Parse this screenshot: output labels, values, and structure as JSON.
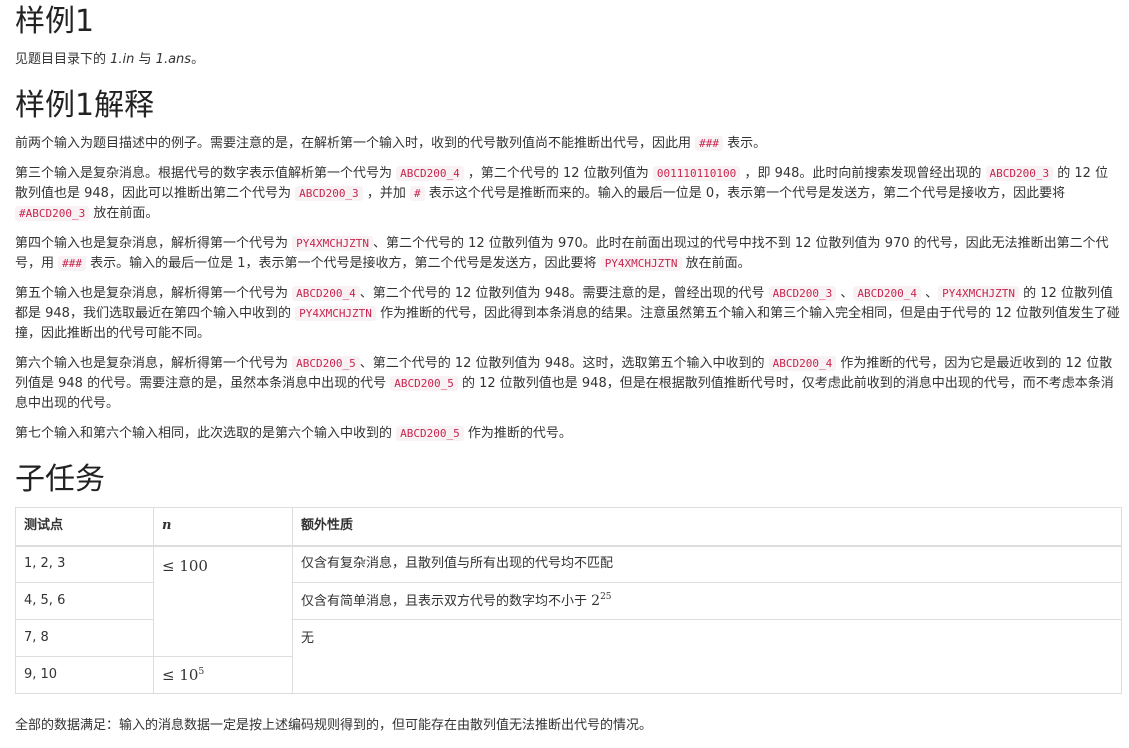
{
  "sample": {
    "title": "样例1",
    "desc_before": "见题目目录下的 ",
    "file_in": "1.in",
    "desc_mid": " 与 ",
    "file_ans": "1.ans",
    "desc_after": "。"
  },
  "explanation": {
    "title": "样例1解释",
    "p1": {
      "t1": "前两个输入为题目描述中的例子。需要注意的是，在解析第一个输入时，收到的代号散列值尚不能推断出代号，因此用 ",
      "c1": "###",
      "t2": " 表示。"
    },
    "p2": {
      "t1": "第三个输入是复杂消息。根据代号的数字表示值解析第一个代号为 ",
      "c1": "ABCD200_4",
      "t2": " ，第二个代号的 12 位散列值为 ",
      "c2": "001110110100",
      "t3": " ，即 948。此时向前搜索发现曾经出现的 ",
      "c3": "ABCD200_3",
      "t4": " 的 12 位散列值也是 948，因此可以推断出第二个代号为 ",
      "c4": "ABCD200_3",
      "t5": " ，并加 ",
      "c5": "#",
      "t6": " 表示这个代号是推断而来的。输入的最后一位是 0，表示第一个代号是发送方，第二个代号是接收方，因此要将 ",
      "c6": "#ABCD200_3",
      "t7": " 放在前面。"
    },
    "p3": {
      "t1": "第四个输入也是复杂消息，解析得第一个代号为 ",
      "c1": "PY4XMCHJZTN",
      "t2": "、第二个代号的 12 位散列值为 970。此时在前面出现过的代号中找不到 12 位散列值为 970 的代号，因此无法推断出第二个代号，用 ",
      "c2": "###",
      "t3": " 表示。输入的最后一位是 1，表示第一个代号是接收方，第二个代号是发送方，因此要将 ",
      "c3": "PY4XMCHJZTN",
      "t4": " 放在前面。"
    },
    "p4": {
      "t1": "第五个输入也是复杂消息，解析得第一个代号为 ",
      "c1": "ABCD200_4",
      "t2": "、第二个代号的 12 位散列值为 948。需要注意的是，曾经出现的代号 ",
      "c2": "ABCD200_3",
      "t3": " 、",
      "c3": "ABCD200_4",
      "t4": " 、",
      "c4": "PY4XMCHJZTN",
      "t5": " 的 12 位散列值都是 948，我们选取最近在第四个输入中收到的 ",
      "c5": "PY4XMCHJZTN",
      "t6": " 作为推断的代号，因此得到本条消息的结果。注意虽然第五个输入和第三个输入完全相同，但是由于代号的 12 位散列值发生了碰撞，因此推断出的代号可能不同。"
    },
    "p5": {
      "t1": "第六个输入也是复杂消息，解析得第一个代号为 ",
      "c1": "ABCD200_5",
      "t2": "、第二个代号的 12 位散列值为 948。这时，选取第五个输入中收到的 ",
      "c2": "ABCD200_4",
      "t3": " 作为推断的代号，因为它是最近收到的 12 位散列值是 948 的代号。需要注意的是，虽然本条消息中出现的代号 ",
      "c3": "ABCD200_5",
      "t4": " 的 12 位散列值也是 948，但是在根据散列值推断代号时，仅考虑此前收到的消息中出现的代号，而不考虑本条消息中出现的代号。"
    },
    "p6": {
      "t1": "第七个输入和第六个输入相同，此次选取的是第六个输入中收到的 ",
      "c1": "ABCD200_5",
      "t2": " 作为推断的代号。"
    }
  },
  "subtasks": {
    "title": "子任务",
    "headers": {
      "tests": "测试点",
      "n": "n",
      "extra": "额外性质"
    },
    "rows": [
      {
        "tests": "1, 2, 3",
        "n_cmp": "≤ ",
        "n_val": "100",
        "n_exp": "",
        "extra": "仅含有复杂消息，且散列值与所有出现的代号均不匹配"
      },
      {
        "tests": "4, 5, 6",
        "extra": "仅含有简单消息，且表示双方代号的数字均不小于 ",
        "extra_base": "2",
        "extra_exp": "25"
      },
      {
        "tests": "7, 8",
        "extra": "无"
      },
      {
        "tests": "9, 10",
        "n_cmp": "≤ ",
        "n_val": "10",
        "n_exp": "5"
      }
    ],
    "footer": "全部的数据满足：输入的消息数据一定是按上述编码规则得到的，但可能存在由散列值无法推断出代号的情况。"
  }
}
